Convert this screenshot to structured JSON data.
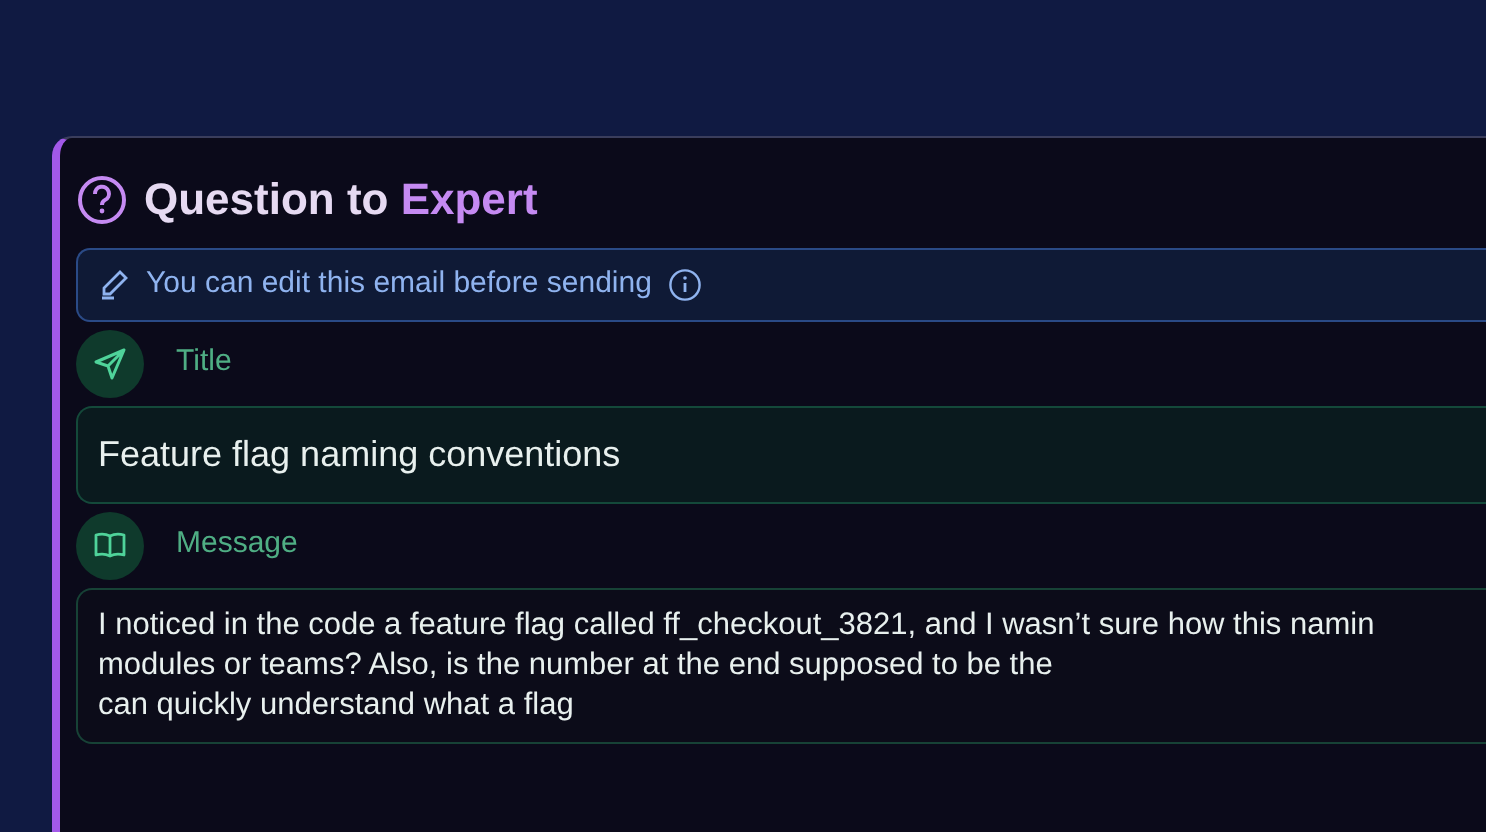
{
  "card": {
    "title_lead": "Question to",
    "title_accent": "Expert",
    "edit_hint": "You can edit this email before sending",
    "fields": [
      {
        "kind": "title",
        "label": "Title",
        "value": "Feature flag naming conventions"
      },
      {
        "kind": "message",
        "label": "Message",
        "lines": [
          "I noticed in the code a feature flag called ff_checkout_3821, and I wasn’t sure how this namin",
          "modules or teams? Also, is the number at the end supposed to be the",
          "can quickly understand what a flag"
        ]
      }
    ]
  }
}
